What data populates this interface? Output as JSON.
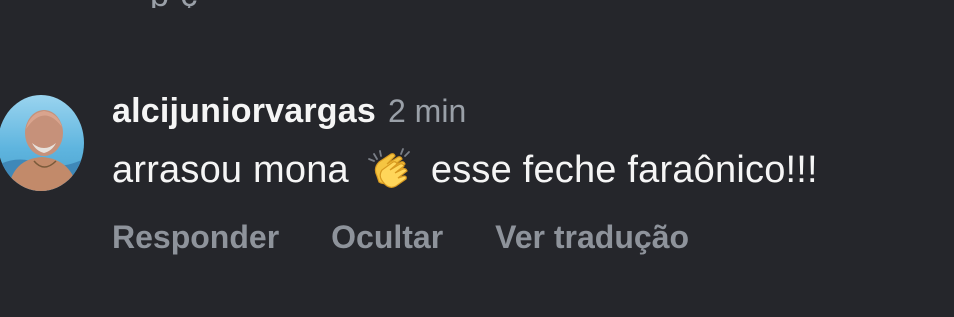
{
  "top_partial": {
    "text": "p                                                                ç"
  },
  "comment": {
    "username": "alcijuniorvargas",
    "time": "2 min",
    "text_before": "arrasou mona",
    "emoji": "clapping-hands-icon",
    "text_after": "esse feche faraônico!!!",
    "actions": {
      "reply": "Responder",
      "hide": "Ocultar",
      "translate": "Ver tradução"
    }
  },
  "colors": {
    "background": "#25262b",
    "primary_text": "#f5f5f5",
    "secondary_text": "#9aa0a8",
    "action_text": "#8e939b"
  }
}
